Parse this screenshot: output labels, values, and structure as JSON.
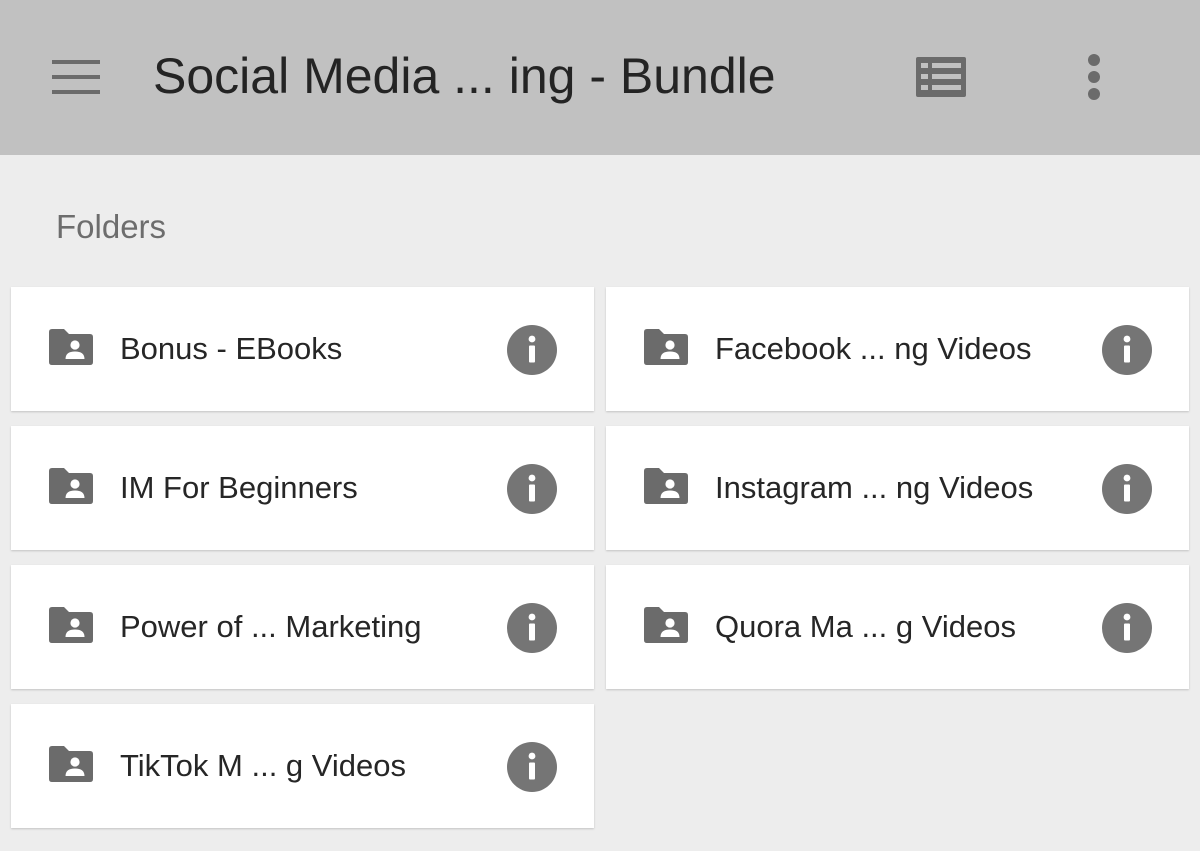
{
  "header": {
    "title": "Social Media ... ing - Bundle",
    "menu_icon": "hamburger-menu-icon",
    "view_icon": "list-view-icon",
    "more_icon": "more-vert-icon",
    "background": "#c1c1c1"
  },
  "section": {
    "label": "Folders"
  },
  "folders": [
    {
      "name": "Bonus - EBooks",
      "icon": "shared-folder-icon"
    },
    {
      "name": "Facebook ... ng Videos",
      "icon": "shared-folder-icon"
    },
    {
      "name": "IM For Beginners",
      "icon": "shared-folder-icon"
    },
    {
      "name": "Instagram ... ng Videos",
      "icon": "shared-folder-icon"
    },
    {
      "name": "Power of ... Marketing",
      "icon": "shared-folder-icon"
    },
    {
      "name": "Quora Ma ... g Videos",
      "icon": "shared-folder-icon"
    },
    {
      "name": "TikTok M ... g Videos",
      "icon": "shared-folder-icon"
    }
  ],
  "colors": {
    "icon_gray": "#6b6b6b",
    "info_gray": "#757575",
    "page_background": "#ededed",
    "card_background": "#ffffff"
  }
}
